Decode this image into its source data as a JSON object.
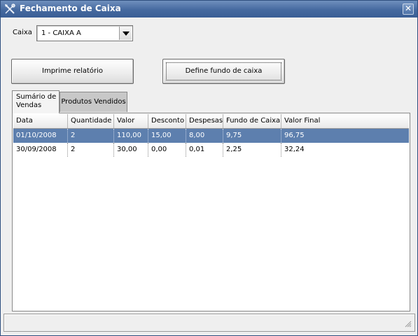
{
  "window": {
    "title": "Fechamento de Caixa",
    "app_icon": "tools-icon",
    "close_icon": "close-icon",
    "close_glyph": "✕"
  },
  "caixa": {
    "label": "Caixa",
    "selected": "1 - CAIXA A"
  },
  "buttons": {
    "print_label": "Imprime relatório",
    "fundo_label": "Define fundo de caixa"
  },
  "tabs": [
    {
      "label": "Sumário de Vendas",
      "active": true
    },
    {
      "label": "Produtos Vendidos",
      "active": false
    }
  ],
  "table": {
    "columns": [
      "Data",
      "Quantidade",
      "Valor",
      "Desconto",
      "Despesas",
      "Fundo de Caixa",
      "Valor Final"
    ],
    "rows": [
      [
        "01/10/2008",
        "2",
        "110,00",
        "15,00",
        "8,00",
        "9,75",
        "96,75"
      ],
      [
        "30/09/2008",
        "2",
        "30,00",
        "0,00",
        "0,01",
        "2,25",
        "32,24"
      ]
    ],
    "selected_row": 0
  },
  "colors": {
    "titlebar": "#45699f",
    "selection": "#5d7fae",
    "inactive_tab": "#c8c8c8"
  }
}
